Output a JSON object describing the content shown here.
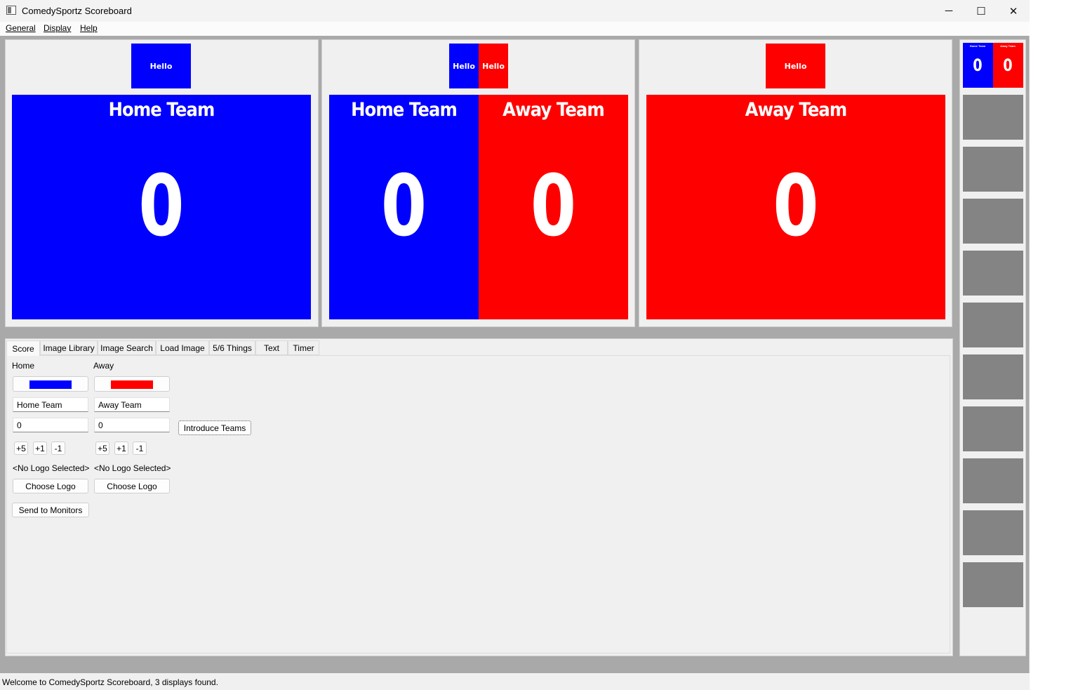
{
  "window": {
    "title": "ComedySportz Scoreboard"
  },
  "titlebar_buttons": {
    "minimize": "─",
    "maximize": "☐",
    "close": "✕"
  },
  "menu": [
    "General",
    "Display",
    "Help"
  ],
  "colors": {
    "home": "#0000ff",
    "away": "#ff0000",
    "thumb": "#848484"
  },
  "previews": {
    "home": {
      "logo": "Hello",
      "team": "Home Team",
      "score": "0"
    },
    "both": {
      "home_logo": "Hello",
      "away_logo": "Hello",
      "home_team": "Home Team",
      "away_team": "Away Team",
      "home_score": "0",
      "away_score": "0"
    },
    "away": {
      "logo": "Hello",
      "team": "Away Team",
      "score": "0"
    }
  },
  "sidebar": {
    "mini": {
      "home_team": "Home Team",
      "away_team": "Away Team",
      "home_score": "0",
      "away_score": "0"
    }
  },
  "tabs": [
    "Score",
    "Image Library",
    "Image Search",
    "Load Image",
    "5/6 Things",
    "Text",
    "Timer"
  ],
  "score_tab": {
    "home": {
      "header": "Home",
      "name": "Home Team",
      "score": "0",
      "logo_status": "<No Logo Selected>",
      "choose_logo": "Choose Logo"
    },
    "away": {
      "header": "Away",
      "name": "Away Team",
      "score": "0",
      "logo_status": "<No Logo Selected>",
      "choose_logo": "Choose Logo"
    },
    "adjust": [
      "+5",
      "+1",
      "-1"
    ],
    "introduce": "Introduce Teams",
    "send": "Send to Monitors"
  },
  "status": "Welcome to ComedySportz Scoreboard, 3 displays found."
}
